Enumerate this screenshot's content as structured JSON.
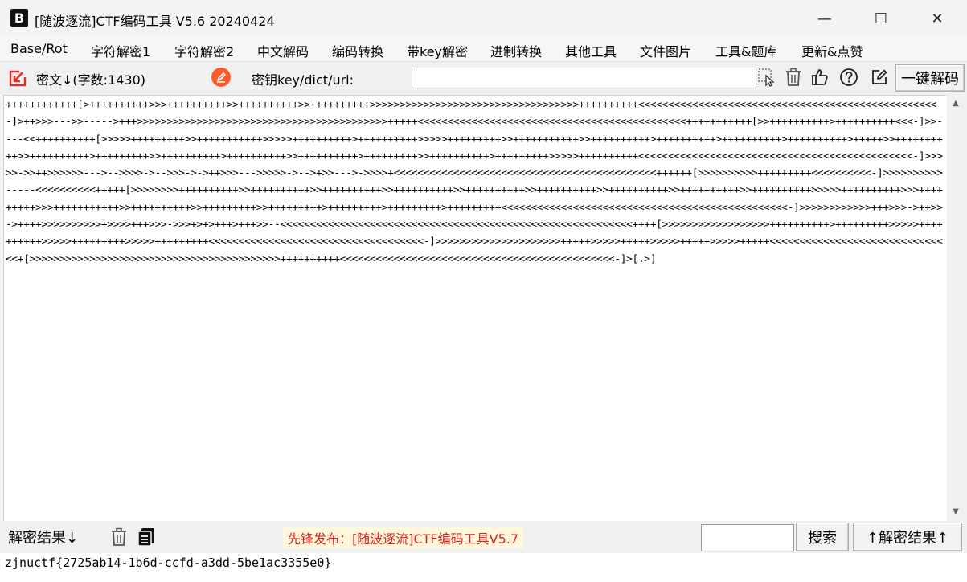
{
  "window": {
    "title": "[随波逐流]CTF编码工具 V5.6 20240424",
    "app_icon_text": "B",
    "minimize": "—",
    "maximize": "☐",
    "close": "✕"
  },
  "menu": [
    "Base/Rot",
    "字符解密1",
    "字符解密2",
    "中文解码",
    "编码转换",
    "带key解密",
    "进制转换",
    "其他工具",
    "文件图片",
    "工具&题库",
    "更新&点赞"
  ],
  "toolbar": {
    "cipher_label": "密文↓(字数:1430)",
    "key_label": "密钥key/dict/url:",
    "key_value": "",
    "decode_button": "一键解码"
  },
  "cipher_text": "++++++++++++[>++++++++++>>>++++++++++>>++++++++++>>++++++++++>>>>>>>>>>>>>>>>>>>>>>>>>>>>>>>>>>>++++++++++<<<<<<<<<<<<<<<<<<<<<<<<<<<<<<<<<<<<<<<<<<<<<<<<<<-]>++>>>--->>----->+++>>>>>>>>>>>>>>>>>>>>>>>>>>>>>>>>>>>>>>>>>>+++++<<<<<<<<<<<<<<<<<<<<<<<<<<<<<<<<<<<<<<<<<<<<<+++++++++++[>>++++++++++>++++++++++<<<-]>>----<<++++++++++[>>>>>+++++++++>>+++++++++++>>>>>++++++++++>++++++++++>>>>>+++++++++>>+++++++++++>>++++++++++>++++++++++>++++++++++>++++++++++>+++++>>++++++++++>>++++++++++>+++++++++>>++++++++++>++++++++++>>++++++++++>+++++++++>>++++++++++>+++++++++>>>>>++++++++++<<<<<<<<<<<<<<<<<<<<<<<<<<<<<<<<<<<<<<<<<<<<<<-]>>>>>->>++>>>>>>--->-->>>>->-->>>->->++>>>--->>>>>->-->+>>--->->>>>+<<<<<<<<<<<<<<<<<<<<<<<<<<<<<<<<<<<<<<<<<<<<++++++[>>>>>>>>>>+++++++++<<<<<<<<<<-]>>>>>>>>>>-----<<<<<<<<<<+++++[>>>>>>>>++++++++++>>++++++++++>>++++++++++>>++++++++++>>++++++++++>>++++++++++>>++++++++++>>++++++++++>>++++++++++>>>>>++++++++++>>>+++++++++>>>+++++++++++>>++++++++++>>+++++++++>>+++++++++>+++++++++>+++++++++>+++++++++<<<<<<<<<<<<<<<<<<<<<<<<<<<<<<<<<<<<<<<<<<<<<<<<-]>>>>>>>>>>>>+++>>>->++>>->++++>>>>>>>>>>+>>>>+++>>>->>>+>+>+++>+++>>--<<<<<<<<<<<<<<<<<<<<<<<<<<<<<<<<<<<<<<<<<<<<<<<<<<<<<<<<<<<++++[>>>>>>>>>>>>>>>>>>++++++++++>+++++++++>>>>>++++++++++>>>>>+++++++++>>>>>+++++++++<<<<<<<<<<<<<<<<<<<<<<<<<<<<<<<<<<<<-]>>>>>>>>>>>>>>>>>>>>>+++++>>>>>+++++>>>>>+++++>>>>>+++++<<<<<<<<<<<<<<<<<<<<<<<<<<<<<<<+[>>>>>>>>>>>>>>>>>>>>>>>>>>>>>>>>>>>>>>>>>>++++++++++<<<<<<<<<<<<<<<<<<<<<<<<<<<<<<<<<<<<<<<<<<<<<<-]>[.>]",
  "bottom": {
    "result_label": "解密结果↓",
    "announcement": "先锋发布：[随波逐流]CTF编码工具V5.7",
    "search_value": "",
    "search_button": "搜索",
    "up_result_button": "↑解密结果↑"
  },
  "result_text": "zjnuctf{2725ab14-1b6d-ccfd-a3dd-5be1ac3355e0}",
  "colors": {
    "announcement_text": "#e02020",
    "announcement_bg": "#fff8dc",
    "edit_icon": "#ff5a2a",
    "import_icon": "#e0322a"
  }
}
